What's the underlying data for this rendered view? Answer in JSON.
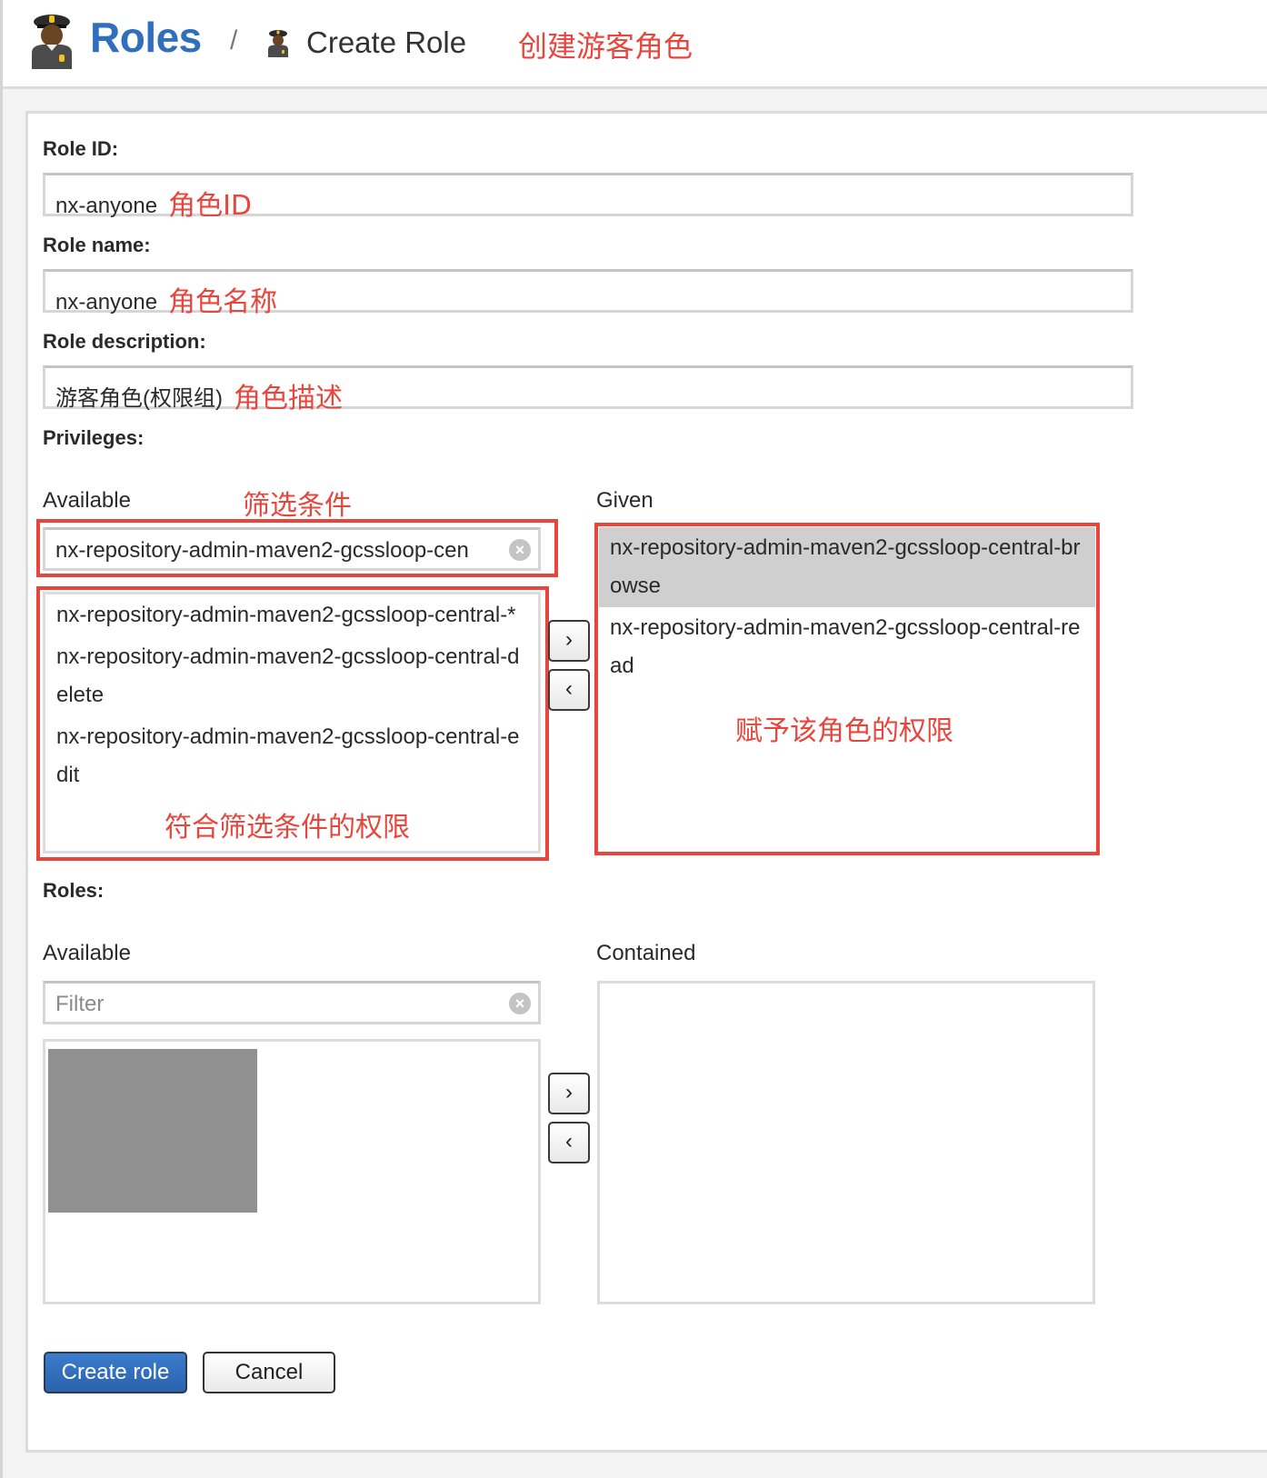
{
  "header": {
    "icon": "police-officer-role-icon",
    "title": "Roles",
    "separator": "/",
    "subtitle": "Create Role",
    "annotation": "创建游客角色"
  },
  "form": {
    "role_id": {
      "label": "Role ID:",
      "value": "nx-anyone",
      "annotation": "角色ID"
    },
    "role_name": {
      "label": "Role name:",
      "value": "nx-anyone",
      "annotation": "角色名称"
    },
    "role_description": {
      "label": "Role description:",
      "value": "游客角色(权限组)",
      "annotation": "角色描述"
    },
    "privileges": {
      "label": "Privileges:",
      "available_label": "Available",
      "given_label": "Given",
      "filter_value": "nx-repository-admin-maven2-gcssloop-cen",
      "filter_annotation": "筛选条件",
      "available_items": [
        "nx-repository-admin-maven2-gcssloop-central-*",
        "nx-repository-admin-maven2-gcssloop-central-delete",
        "nx-repository-admin-maven2-gcssloop-central-edit"
      ],
      "available_annotation": "符合筛选条件的权限",
      "given_items": [
        {
          "label": "nx-repository-admin-maven2-gcssloop-central-browse",
          "selected": true
        },
        {
          "label": "nx-repository-admin-maven2-gcssloop-central-read",
          "selected": false
        }
      ],
      "given_annotation": "赋予该角色的权限",
      "move_right": "›",
      "move_left": "‹"
    },
    "roles": {
      "label": "Roles:",
      "available_label": "Available",
      "contained_label": "Contained",
      "filter_placeholder": "Filter",
      "move_right": "›",
      "move_left": "‹"
    }
  },
  "actions": {
    "create_label": "Create role",
    "cancel_label": "Cancel"
  },
  "colors": {
    "accent": "#2f6fbd",
    "annotation": "#e8453c",
    "selected_row": "#cfcfcf"
  }
}
